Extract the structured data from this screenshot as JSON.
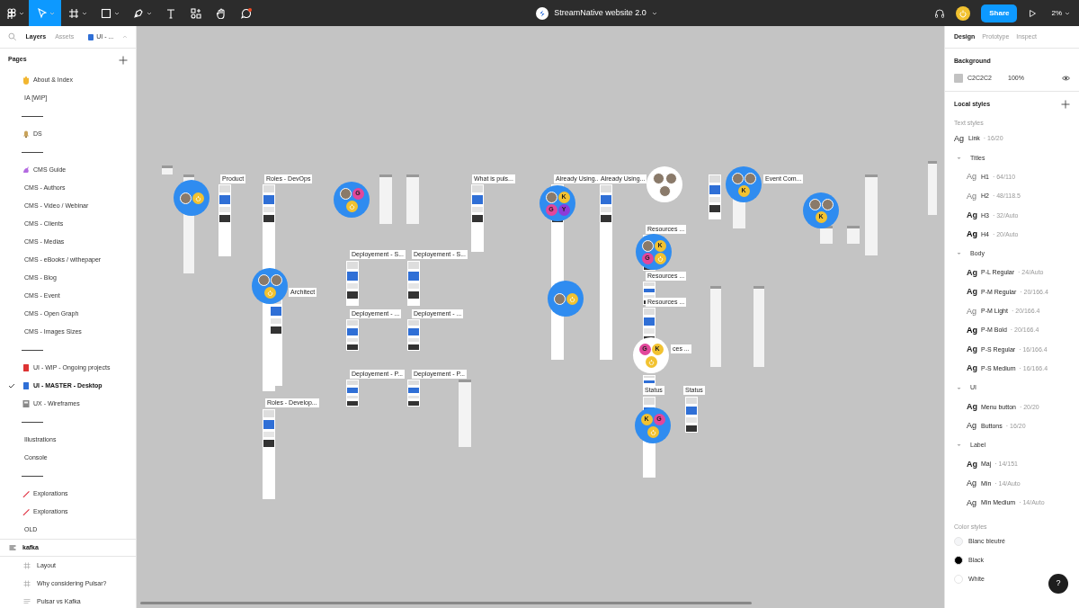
{
  "toolbar": {
    "tools": [
      {
        "kind": "menu",
        "selected": false
      },
      {
        "kind": "move",
        "selected": true
      },
      {
        "kind": "frame",
        "selected": false
      },
      {
        "kind": "shape",
        "selected": false
      },
      {
        "kind": "pen",
        "selected": false
      },
      {
        "kind": "text",
        "selected": false
      },
      {
        "kind": "resources",
        "selected": false
      },
      {
        "kind": "hand",
        "selected": false
      },
      {
        "kind": "comment",
        "selected": false
      }
    ],
    "file_title": "StreamNative website 2.0",
    "share": "Share",
    "zoom": "2%"
  },
  "left_panel": {
    "tabs": [
      {
        "label": "Layers",
        "selected": true
      },
      {
        "label": "Assets",
        "selected": false
      }
    ],
    "page_switch": "UI - ...",
    "pages_heading": "Pages",
    "pages": [
      {
        "kind": "page",
        "label": "About & Index",
        "selected": false
      },
      {
        "kind": "page",
        "label": "IA [WIP]",
        "selected": false
      },
      {
        "kind": "separator"
      },
      {
        "kind": "page",
        "label": "DS",
        "selected": false
      },
      {
        "kind": "separator"
      },
      {
        "kind": "page",
        "label": "CMS Guide",
        "selected": false
      },
      {
        "kind": "page",
        "label": "CMS - Authors",
        "selected": false
      },
      {
        "kind": "page",
        "label": "CMS - Video / Webinar",
        "selected": false
      },
      {
        "kind": "page",
        "label": "CMS - Clients",
        "selected": false
      },
      {
        "kind": "page",
        "label": "CMS - Medias",
        "selected": false
      },
      {
        "kind": "page",
        "label": "CMS - eBooks / withepaper",
        "selected": false
      },
      {
        "kind": "page",
        "label": "CMS - Blog",
        "selected": false
      },
      {
        "kind": "page",
        "label": "CMS - Event",
        "selected": false
      },
      {
        "kind": "page",
        "label": "CMS - Open Graph",
        "selected": false
      },
      {
        "kind": "page",
        "label": "CMS - Images Sizes",
        "selected": false
      },
      {
        "kind": "separator"
      },
      {
        "kind": "page",
        "label": "UI - WIP - Ongoing projects",
        "selected": false
      },
      {
        "kind": "page",
        "label": "UI - MASTER -  Desktop",
        "selected": true
      },
      {
        "kind": "page",
        "label": "UX - Wireframes",
        "selected": false
      },
      {
        "kind": "separator"
      },
      {
        "kind": "page",
        "label": "Illustrations",
        "selected": false
      },
      {
        "kind": "page",
        "label": "Console",
        "selected": false
      },
      {
        "kind": "separator"
      },
      {
        "kind": "page",
        "label": "Explorations",
        "selected": false
      },
      {
        "kind": "page",
        "label": "Explorations",
        "selected": false
      },
      {
        "kind": "page",
        "label": "OLD",
        "selected": false
      }
    ],
    "layers": [
      {
        "kind": "section",
        "label": "kafka",
        "children": [
          {
            "kind": "frame",
            "label": "Layout"
          },
          {
            "kind": "frame",
            "label": "Why considering Pulsar?"
          },
          {
            "kind": "text",
            "label": "Pulsar vs Kafka"
          }
        ]
      }
    ]
  },
  "canvas": {
    "frames": [
      {
        "label": "Product"
      },
      {
        "label": "Roles - DevOps"
      },
      {
        "label": "Architect"
      },
      {
        "label": "Roles - Develop..."
      },
      {
        "label": "What is puls..."
      },
      {
        "label": "Already Using..."
      },
      {
        "label": "Already Using..."
      },
      {
        "label": "Deployement - S..."
      },
      {
        "label": "Deployement - S..."
      },
      {
        "label": "Deployement - ..."
      },
      {
        "label": "Deployement - ..."
      },
      {
        "label": "Deployement - P..."
      },
      {
        "label": "Deployement - P..."
      },
      {
        "label": "Resources ..."
      },
      {
        "label": "Resources ..."
      },
      {
        "label": "Resources ..."
      },
      {
        "label": "ces ..."
      },
      {
        "label": "Event Com..."
      },
      {
        "label": "Status"
      },
      {
        "label": "Status"
      }
    ],
    "cursors": [
      {
        "members": [
          {
            "kind": "photo"
          },
          {
            "kind": "power"
          }
        ]
      },
      {
        "members": [
          {
            "kind": "photo"
          },
          {
            "kind": "initial",
            "letter": "G",
            "color": "#e2479b"
          },
          {
            "kind": "power"
          }
        ]
      },
      {
        "members": [
          {
            "kind": "photo"
          },
          {
            "kind": "photo"
          },
          {
            "kind": "power"
          }
        ]
      },
      {
        "members": [
          {
            "kind": "photo"
          },
          {
            "kind": "initial",
            "letter": "K",
            "color": "#f2c230"
          },
          {
            "kind": "initial",
            "letter": "G",
            "color": "#e2479b"
          },
          {
            "kind": "initial",
            "letter": "Y",
            "color": "#8e3ad8"
          }
        ]
      },
      {
        "members": [
          {
            "kind": "photo"
          },
          {
            "kind": "photo"
          },
          {
            "kind": "photo"
          }
        ]
      },
      {
        "members": [
          {
            "kind": "photo"
          },
          {
            "kind": "photo"
          },
          {
            "kind": "initial",
            "letter": "K",
            "color": "#f2c230"
          }
        ]
      },
      {
        "members": [
          {
            "kind": "photo"
          },
          {
            "kind": "photo"
          },
          {
            "kind": "initial",
            "letter": "K",
            "color": "#f2c230"
          }
        ]
      },
      {
        "members": [
          {
            "kind": "photo"
          },
          {
            "kind": "initial",
            "letter": "K",
            "color": "#f2c230"
          },
          {
            "kind": "initial",
            "letter": "G",
            "color": "#e2479b"
          },
          {
            "kind": "power"
          }
        ]
      },
      {
        "members": [
          {
            "kind": "photo"
          },
          {
            "kind": "power"
          }
        ]
      },
      {
        "members": [
          {
            "kind": "initial",
            "letter": "G",
            "color": "#e2479b"
          },
          {
            "kind": "initial",
            "letter": "K",
            "color": "#f2c230"
          },
          {
            "kind": "power"
          }
        ]
      },
      {
        "members": [
          {
            "kind": "initial",
            "letter": "K",
            "color": "#f2c230"
          },
          {
            "kind": "initial",
            "letter": "G",
            "color": "#e2479b"
          },
          {
            "kind": "power"
          }
        ]
      }
    ]
  },
  "right_panel": {
    "tabs": [
      {
        "label": "Design",
        "selected": true
      },
      {
        "label": "Prototype",
        "selected": false
      },
      {
        "label": "Inspect",
        "selected": false
      }
    ],
    "background": {
      "heading": "Background",
      "color": "#c2c2c2",
      "hex": "C2C2C2",
      "opacity": "100%"
    },
    "local_styles": "Local styles",
    "text_styles_heading": "Text styles",
    "text_styles": [
      {
        "kind": "style",
        "sample": "Ag",
        "name": "Link",
        "spec": "· 16/20"
      },
      {
        "kind": "group",
        "name": "Titles",
        "children": [
          {
            "kind": "style",
            "sample": "Ag",
            "name": "H1",
            "spec": "· 64/110"
          },
          {
            "kind": "style",
            "sample": "Ag",
            "name": "H2",
            "spec": "· 48/118.5"
          },
          {
            "kind": "style",
            "sample": "Ag",
            "name": "H3",
            "spec": "· 32/Auto"
          },
          {
            "kind": "style",
            "sample": "Ag",
            "name": "H4",
            "spec": "· 20/Auto"
          }
        ]
      },
      {
        "kind": "group",
        "name": "Body",
        "children": [
          {
            "kind": "style",
            "sample": "Ag",
            "name": "P-L Regular",
            "spec": "· 24/Auto"
          },
          {
            "kind": "style",
            "sample": "Ag",
            "name": "P-M Regular",
            "spec": "· 20/166.4"
          },
          {
            "kind": "style",
            "sample": "Ag",
            "name": "P-M Light",
            "spec": "· 20/166.4"
          },
          {
            "kind": "style",
            "sample": "Ag",
            "name": "P-M Bold",
            "spec": "· 20/166.4"
          },
          {
            "kind": "style",
            "sample": "Ag",
            "name": "P-S Regular",
            "spec": "· 16/166.4"
          },
          {
            "kind": "style",
            "sample": "Ag",
            "name": "P-S Medium",
            "spec": "· 16/166.4"
          }
        ]
      },
      {
        "kind": "group",
        "name": "UI",
        "children": [
          {
            "kind": "style",
            "sample": "Ag",
            "name": "Menu button",
            "spec": "· 20/20"
          },
          {
            "kind": "style",
            "sample": "Ag",
            "name": "Buttons",
            "spec": "· 16/20"
          }
        ]
      },
      {
        "kind": "group",
        "name": "Label",
        "children": [
          {
            "kind": "style",
            "sample": "Ag",
            "name": "Maj",
            "spec": "· 14/151"
          },
          {
            "kind": "style",
            "sample": "Ag",
            "name": "Min",
            "spec": "· 14/Auto"
          },
          {
            "kind": "style",
            "sample": "Ag",
            "name": "Min Medium",
            "spec": "· 14/Auto"
          }
        ]
      }
    ],
    "color_styles_heading": "Color styles",
    "color_styles": [
      {
        "name": "Blanc bleutré",
        "color": "#f4f5f7"
      },
      {
        "name": "Black",
        "color": "#000000"
      },
      {
        "name": "White",
        "color": "#ffffff"
      }
    ],
    "help": "?"
  }
}
